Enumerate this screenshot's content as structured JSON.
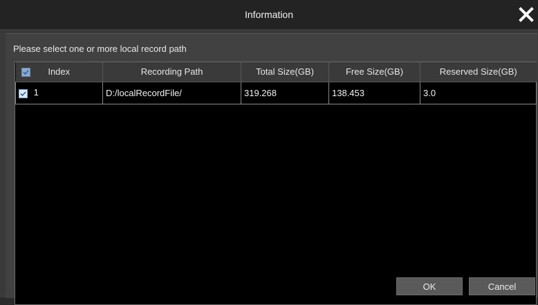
{
  "window": {
    "title": "Information",
    "close_icon": "close-icon"
  },
  "prompt": "Please select one or more local record path",
  "table": {
    "headers": {
      "index": "Index",
      "path": "Recording Path",
      "total": "Total Size(GB)",
      "free": "Free Size(GB)",
      "reserved": "Reserved Size(GB)"
    },
    "header_checked": true,
    "rows": [
      {
        "checked": true,
        "index": "1",
        "path": "D:/localRecordFile/",
        "total": "319.268",
        "free": "138.453",
        "reserved": "3.0"
      }
    ]
  },
  "buttons": {
    "ok": "OK",
    "cancel": "Cancel"
  },
  "colors": {
    "titlebar": "#232323",
    "body": "#414141",
    "table_bg": "#000000",
    "checkbox": "#dfe9f5"
  }
}
